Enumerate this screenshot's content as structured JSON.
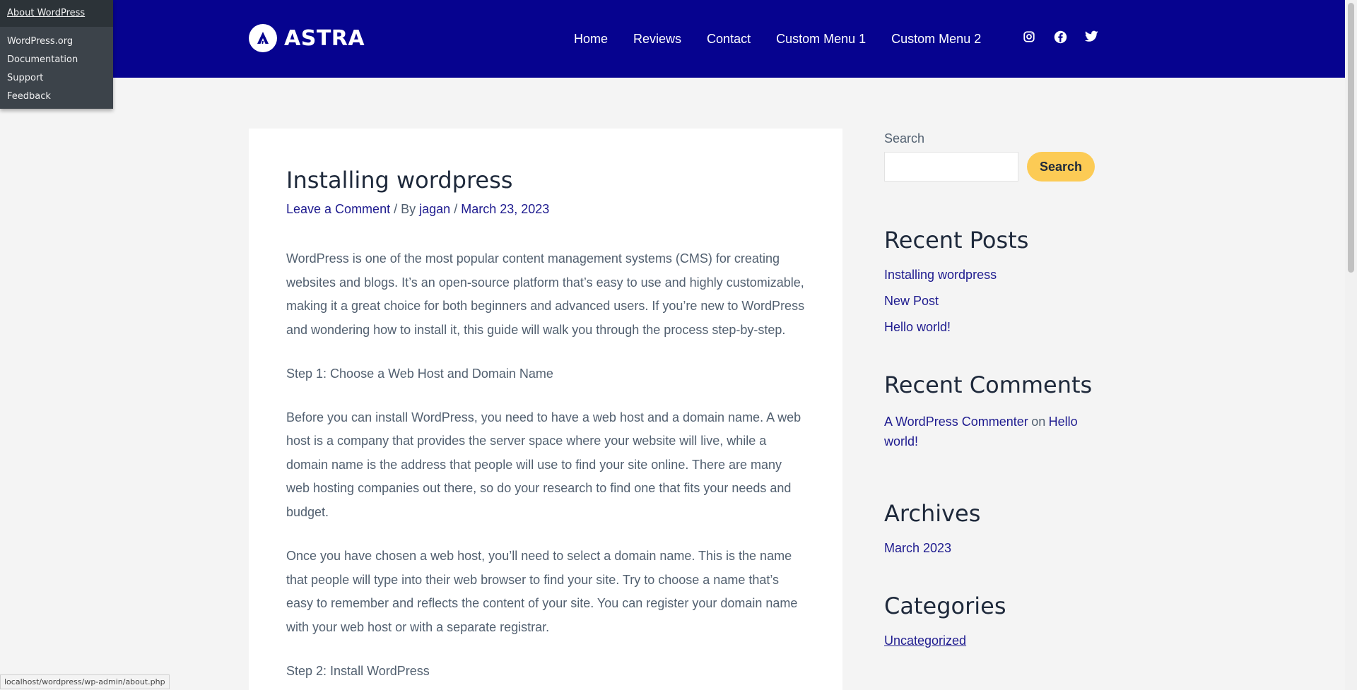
{
  "admin_menu": {
    "about": "About WordPress",
    "links": [
      "WordPress.org",
      "Documentation",
      "Support",
      "Feedback"
    ]
  },
  "header": {
    "logo_text": "ASTRA",
    "nav": [
      "Home",
      "Reviews",
      "Contact",
      "Custom Menu 1",
      "Custom Menu 2"
    ],
    "social_icons": [
      "instagram-icon",
      "facebook-icon",
      "twitter-icon"
    ],
    "background": "#06038f"
  },
  "article": {
    "title": "Installing wordpress",
    "meta": {
      "comment_link": "Leave a Comment",
      "by": "/ By",
      "author": "jagan",
      "sep": "/",
      "date": "March 23, 2023"
    },
    "paragraphs": [
      "WordPress is one of the most popular content management systems (CMS) for creating websites and blogs. It’s an open-source platform that’s easy to use and highly customizable, making it a great choice for both beginners and advanced users. If you’re new to WordPress and wondering how to install it, this guide will walk you through the process step-by-step.",
      "Step 1: Choose a Web Host and Domain Name",
      "Before you can install WordPress, you need to have a web host and a domain name. A web host is a company that provides the server space where your website will live, while a domain name is the address that people will use to find your site online. There are many web hosting companies out there, so do your research to find one that fits your needs and budget.",
      "Once you have chosen a web host, you’ll need to select a domain name. This is the name that people will type into their web browser to find your site. Try to choose a name that’s easy to remember and reflects the content of your site. You can register your domain name with your web host or with a separate registrar.",
      "Step 2: Install WordPress"
    ]
  },
  "sidebar": {
    "search_label": "Search",
    "search_button": "Search",
    "search_value": "",
    "recent_posts_title": "Recent Posts",
    "recent_posts": [
      "Installing wordpress",
      "New Post",
      "Hello world!"
    ],
    "recent_comments_title": "Recent Comments",
    "comment": {
      "author": "A WordPress Commenter",
      "on": "on",
      "post": "Hello world!"
    },
    "archives_title": "Archives",
    "archives": [
      "March 2023"
    ],
    "categories_title": "Categories",
    "categories": [
      "Uncategorized"
    ]
  },
  "statusbar": "localhost/wordpress/wp-admin/about.php",
  "colors": {
    "accent": "#06038f",
    "button": "#fccb55",
    "link": "#1e1b8f"
  }
}
